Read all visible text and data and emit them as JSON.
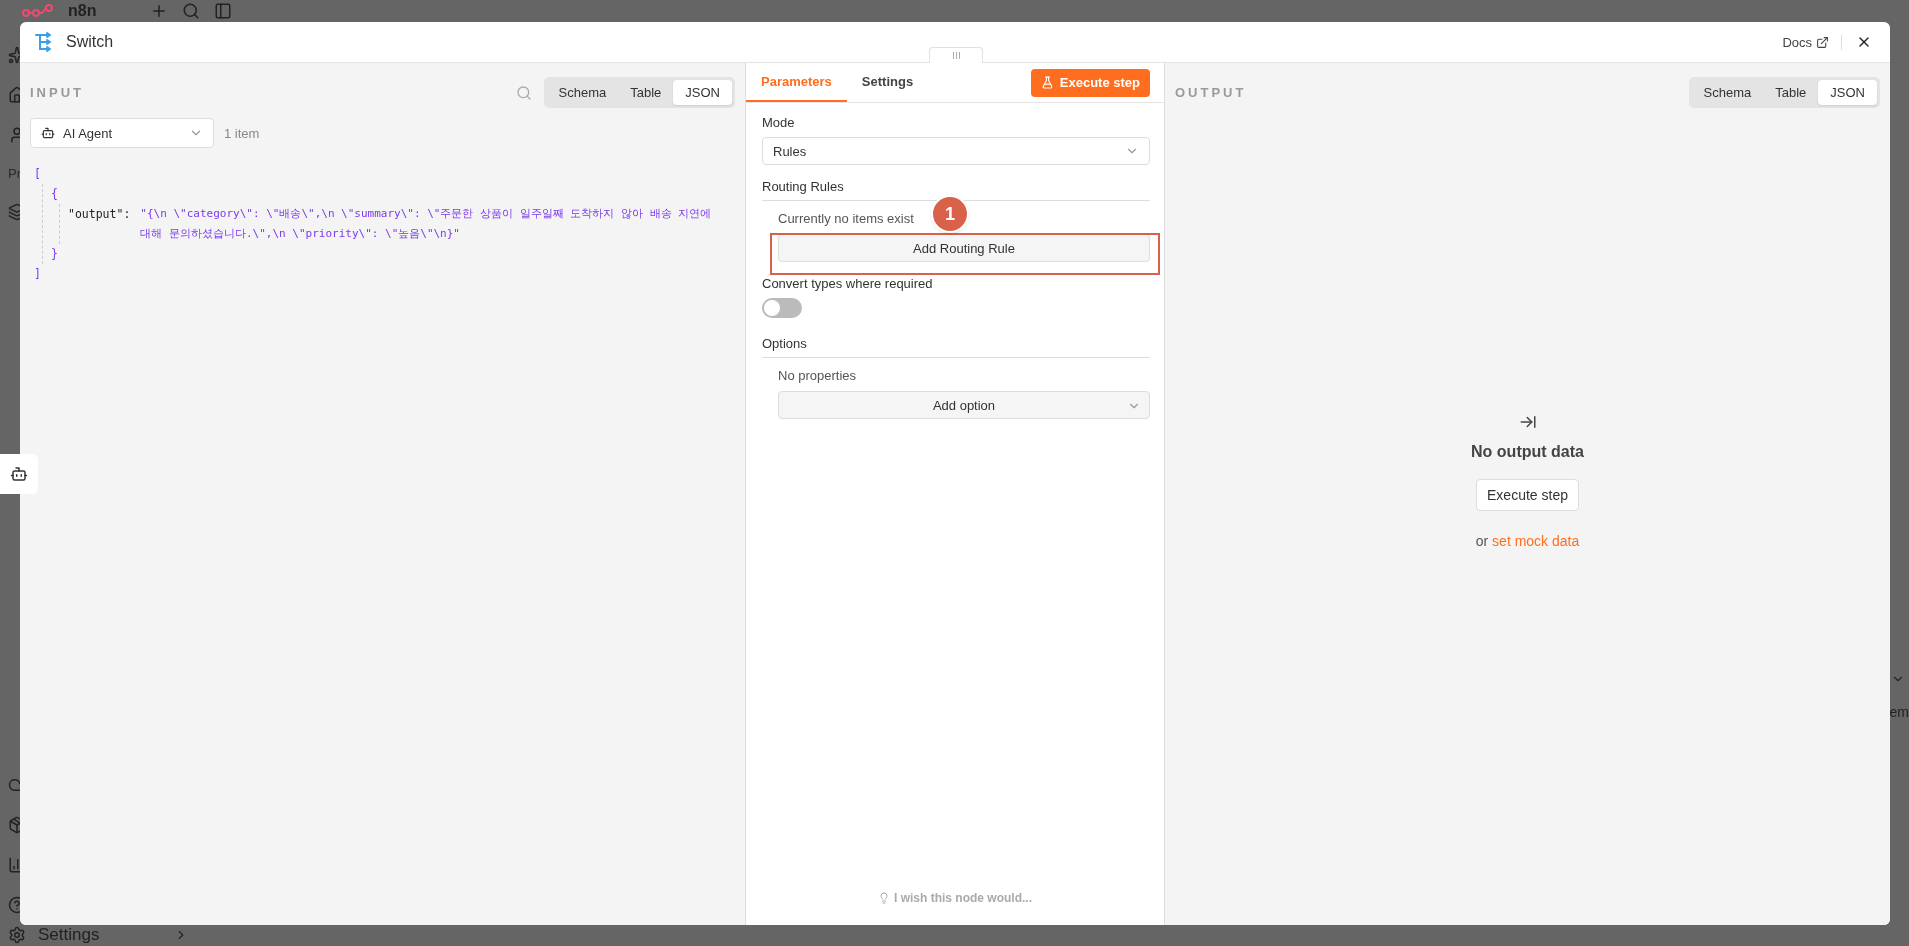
{
  "background": {
    "logo": "n8n",
    "section_label": "Pr",
    "settings_label": "Settings",
    "right_fragment": "em"
  },
  "window": {
    "title": "Switch",
    "docs_link": "Docs"
  },
  "input_panel": {
    "title": "INPUT",
    "view_tabs": [
      {
        "label": "Schema",
        "selected": false
      },
      {
        "label": "Table",
        "selected": false
      },
      {
        "label": "JSON",
        "selected": true
      }
    ],
    "source": {
      "value": "AI Agent"
    },
    "item_count": "1 item",
    "json_view": {
      "open": "[",
      "item_open": "{",
      "key": "\"output\":",
      "value": "\"{\\n  \\\"category\\\": \\\"배송\\\",\\n  \\\"summary\\\": \\\"주문한 상품이 일주일째 도착하지 않아 배송 지연에 대해 문의하셨습니다.\\\",\\n  \\\"priority\\\": \\\"높음\\\"\\n}\"",
      "item_close": "}",
      "close": "]"
    }
  },
  "parameters_panel": {
    "tabs": [
      {
        "label": "Parameters",
        "selected": true
      },
      {
        "label": "Settings",
        "selected": false
      }
    ],
    "execute_button": "Execute step",
    "mode": {
      "label": "Mode",
      "value": "Rules"
    },
    "routing_rules": {
      "label": "Routing Rules",
      "empty_text": "Currently no items exist",
      "add_button": "Add Routing Rule",
      "annotation": "1"
    },
    "convert_types": {
      "label": "Convert types where required",
      "on": false
    },
    "options": {
      "label": "Options",
      "empty_text": "No properties",
      "add_button": "Add option"
    },
    "feedback": "I wish this node would..."
  },
  "output_panel": {
    "title": "OUTPUT",
    "view_tabs": [
      {
        "label": "Schema",
        "selected": false
      },
      {
        "label": "Table",
        "selected": false
      },
      {
        "label": "JSON",
        "selected": true
      }
    ],
    "empty_title": "No output data",
    "execute_button": "Execute step",
    "mock_prefix": "or",
    "mock_link": "set mock data"
  }
}
